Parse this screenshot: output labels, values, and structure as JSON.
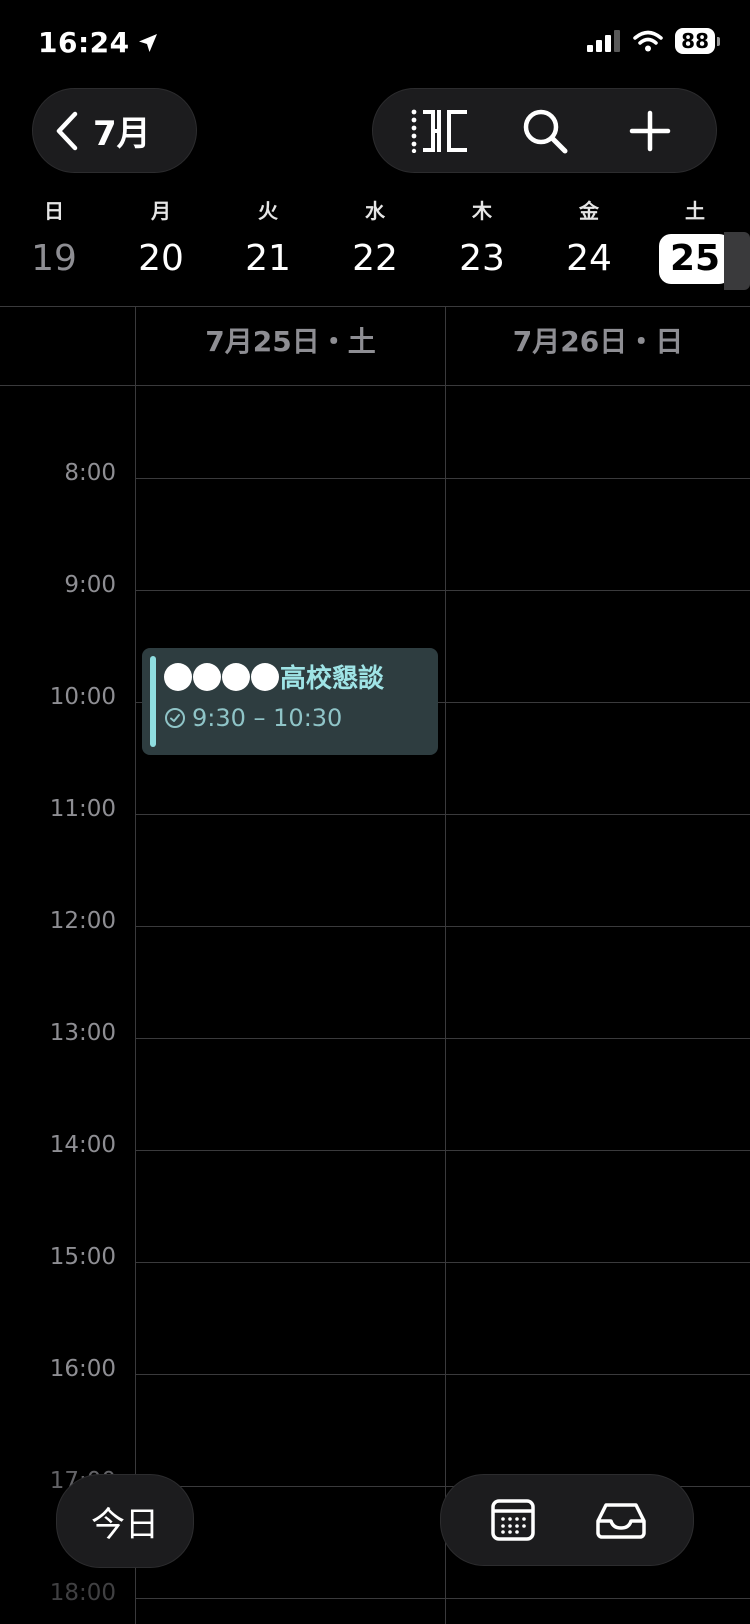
{
  "status_bar": {
    "time": "16:24",
    "battery": "88"
  },
  "nav": {
    "back_label": "7月"
  },
  "week": [
    {
      "weekday": "日",
      "date": "19",
      "state": "past"
    },
    {
      "weekday": "月",
      "date": "20",
      "state": "normal"
    },
    {
      "weekday": "火",
      "date": "21",
      "state": "normal"
    },
    {
      "weekday": "水",
      "date": "22",
      "state": "normal"
    },
    {
      "weekday": "木",
      "date": "23",
      "state": "normal"
    },
    {
      "weekday": "金",
      "date": "24",
      "state": "normal"
    },
    {
      "weekday": "土",
      "date": "25",
      "state": "today"
    }
  ],
  "columns": [
    {
      "header": "7月25日・土"
    },
    {
      "header": "7月26日・日"
    }
  ],
  "hours": [
    "8:00",
    "9:00",
    "10:00",
    "11:00",
    "12:00",
    "13:00",
    "14:00",
    "15:00",
    "16:00",
    "17:00",
    "18:00"
  ],
  "event": {
    "title": "高校懇談",
    "time": "9:30 – 10:30"
  },
  "bottom": {
    "today_label": "今日"
  },
  "colors": {
    "event_bg": "#2e3d40",
    "event_accent": "#8fdde0"
  }
}
